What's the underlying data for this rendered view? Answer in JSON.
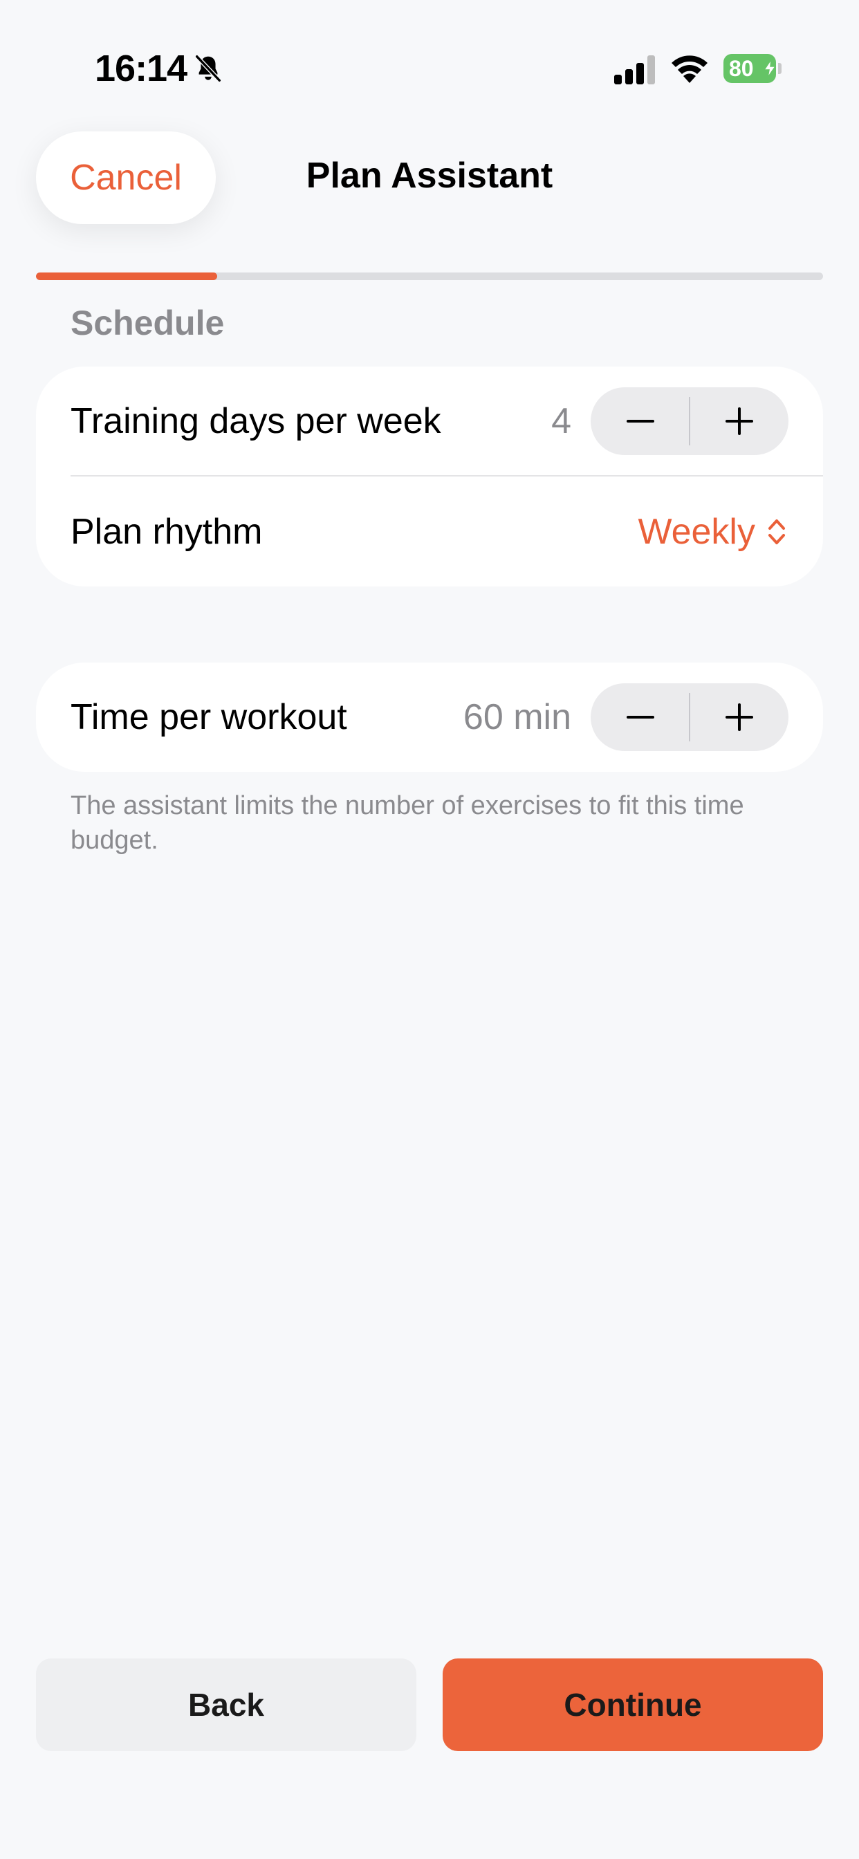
{
  "status_bar": {
    "time": "16:14",
    "battery_percent": "80"
  },
  "header": {
    "cancel_label": "Cancel",
    "title": "Plan Assistant"
  },
  "progress": {
    "fraction": 0.23
  },
  "schedule": {
    "section_title": "Schedule",
    "training_days": {
      "label": "Training days per week",
      "value": "4"
    },
    "plan_rhythm": {
      "label": "Plan rhythm",
      "value": "Weekly"
    }
  },
  "time_per_workout": {
    "label": "Time per workout",
    "value": "60 min",
    "footnote": "The assistant limits the number of exercises to fit this time budget."
  },
  "footer": {
    "back_label": "Back",
    "continue_label": "Continue"
  },
  "colors": {
    "accent": "#ea6039",
    "background": "#f7f8fa",
    "card": "#ffffff",
    "secondary_text": "#8a8a8e"
  },
  "icons": {
    "status": [
      "bell-slash-icon",
      "cellular-signal-icon",
      "wifi-icon",
      "battery-icon",
      "charging-bolt-icon"
    ],
    "stepper": [
      "minus-icon",
      "plus-icon"
    ],
    "picker": "chevron-up-down-icon"
  }
}
